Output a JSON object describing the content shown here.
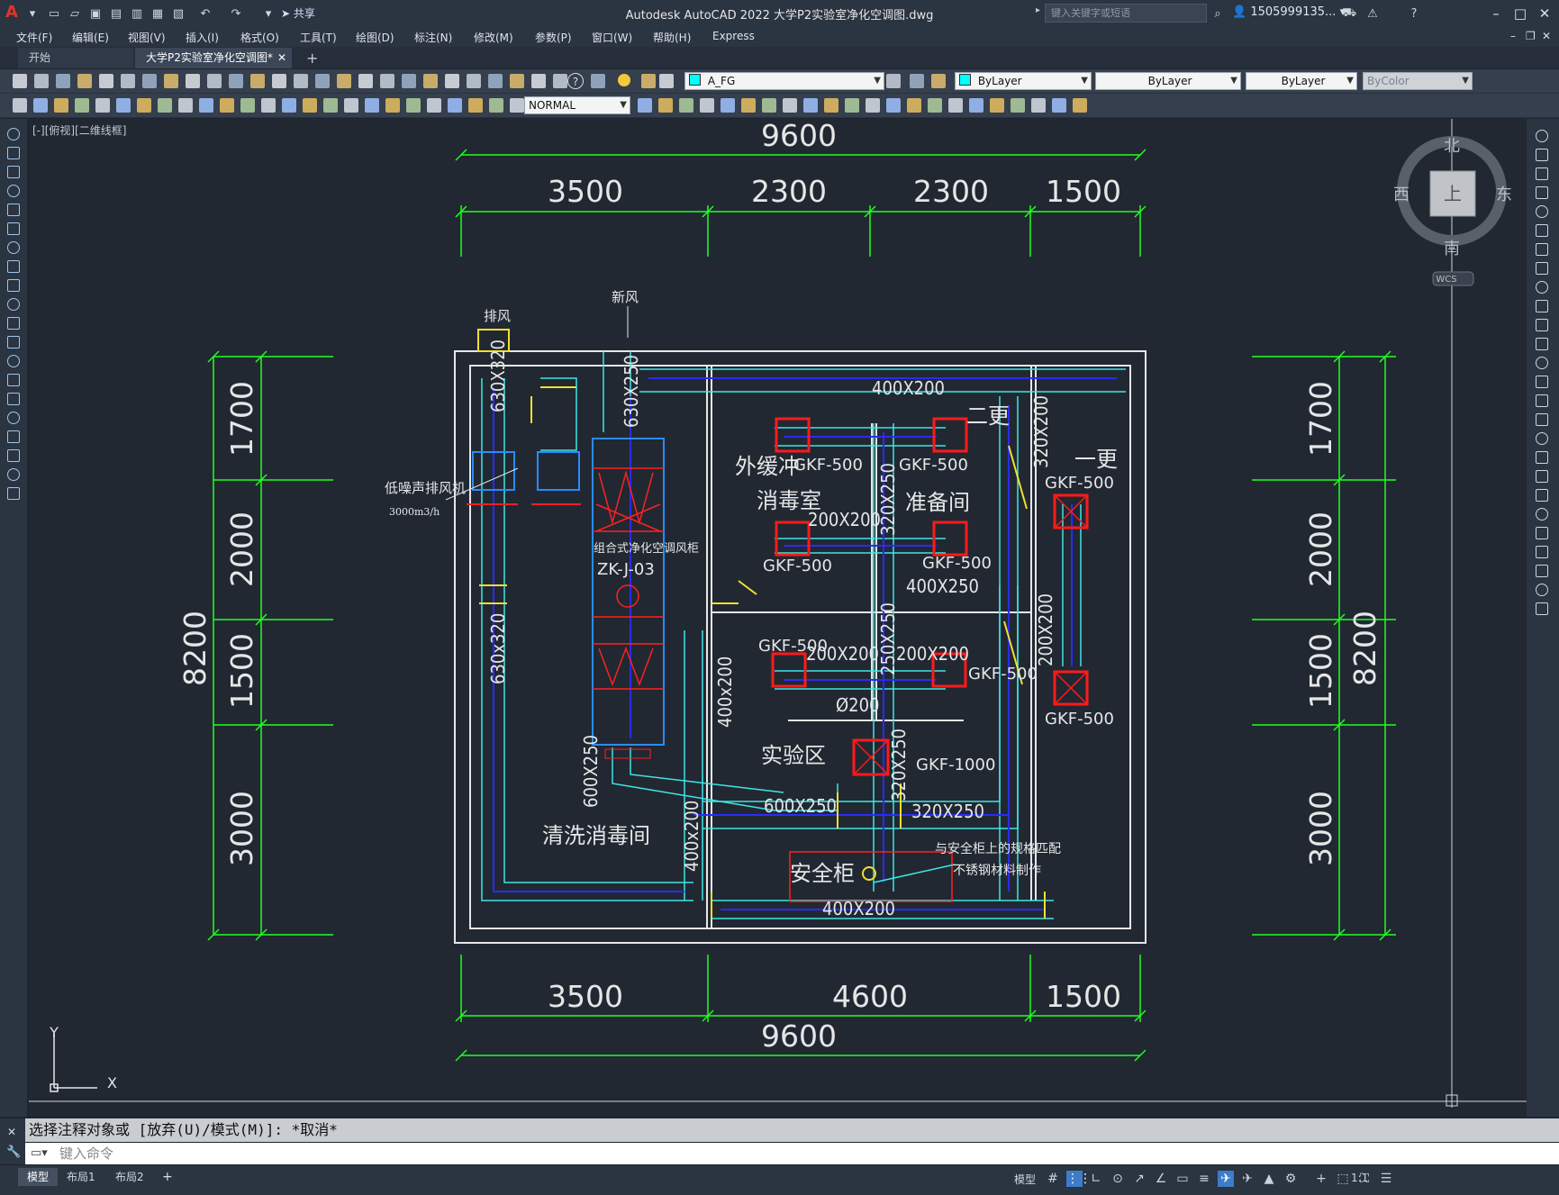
{
  "app": {
    "title": "Autodesk AutoCAD 2022    大学P2实验室净化空调图.dwg",
    "share_label": "共享",
    "search_placeholder": "键入关键字或短语",
    "user": "1505999135...",
    "window_controls": [
      "minimize-icon",
      "maximize-icon",
      "close-icon"
    ]
  },
  "menu": [
    "文件(F)",
    "编辑(E)",
    "视图(V)",
    "插入(I)",
    "格式(O)",
    "工具(T)",
    "绘图(D)",
    "标注(N)",
    "修改(M)",
    "参数(P)",
    "窗口(W)",
    "帮助(H)",
    "Express"
  ],
  "tabs": [
    {
      "label": "开始",
      "active": false
    },
    {
      "label": "大学P2实验室净化空调图*",
      "active": true
    }
  ],
  "toolbar": {
    "layer": "A_FG",
    "color": "ByLayer",
    "linetype": "ByLayer",
    "lineweight": "ByLayer",
    "plotstyle": "ByColor",
    "text_style": "NORMAL"
  },
  "viewport_label": "[-][俯视][二维线框]",
  "viewcube": {
    "north": "北",
    "south": "南",
    "east": "东",
    "west": "西",
    "face": "上",
    "ucs": "WCS"
  },
  "ucs_icon": {
    "x": "X",
    "y": "Y"
  },
  "drawing": {
    "top_total": "9600",
    "top_dims": [
      "3500",
      "2300",
      "2300",
      "1500"
    ],
    "bottom_dims": [
      "3500",
      "4600",
      "1500"
    ],
    "bottom_total": "9600",
    "side_dims": [
      "1700",
      "2000",
      "1500",
      "3000"
    ],
    "side_total": "8200",
    "rooms": {
      "buffer": "外缓冲",
      "disinfect": "消毒室",
      "prep": "准备间",
      "lab": "实验区",
      "wash": "清洗消毒间",
      "change2": "二更",
      "change1": "一更",
      "cabinet": "安全柜"
    },
    "ducts": [
      "400X200",
      "200X200",
      "320X250",
      "400X250",
      "250X250",
      "200X200",
      "200X200",
      "Ø200",
      "400x200",
      "630X320",
      "630X250",
      "630x320",
      "600X250",
      "600X250",
      "320X250",
      "320X250",
      "400x200",
      "400X200",
      "200X200",
      "320X200"
    ],
    "labels": {
      "exhaust": "排风",
      "fresh": "新风",
      "fan": "低噪声排风机",
      "fan_flow": "3000m3/h",
      "ahu": "组合式净化空调风柜",
      "ahu_model": "ZK-J-03",
      "note1": "与安全柜上的规格匹配",
      "note2": "不锈钢材料制作"
    },
    "gkf": [
      "GKF-500",
      "GKF-500",
      "GKF-500",
      "GKF-500",
      "GKF-500",
      "GKF-500",
      "GKF-500",
      "GKF-500",
      "GKF-1000"
    ]
  },
  "command": {
    "history": "选择注释对象或 [放弃(U)/模式(M)]: *取消*",
    "placeholder": "键入命令"
  },
  "status": {
    "layout_tabs": [
      "模型",
      "布局1",
      "布局2"
    ],
    "model_label": "模型",
    "scale": "1:1"
  }
}
